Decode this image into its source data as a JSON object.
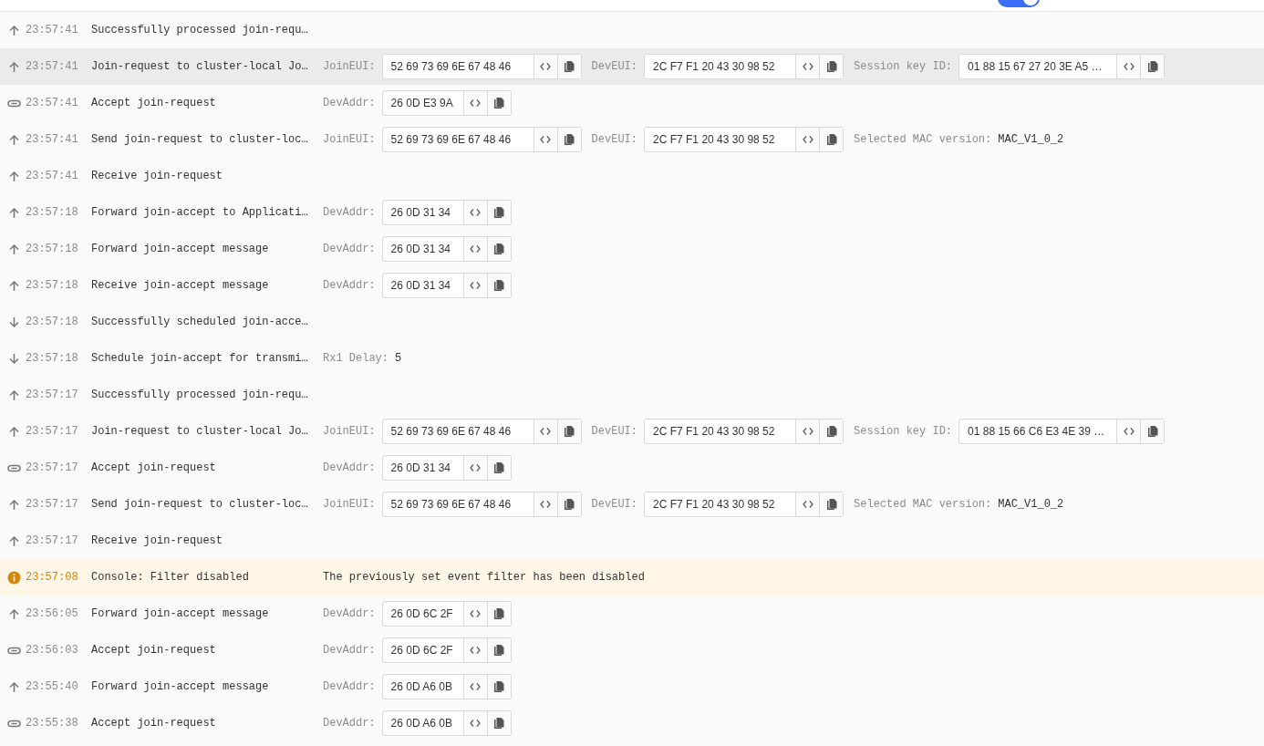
{
  "top_bar": {
    "toggle": {
      "on": true
    }
  },
  "events": [
    {
      "kind": "up",
      "time": "23:57:41",
      "title": "Successfully processed join-requ…",
      "selected": false
    },
    {
      "kind": "up",
      "time": "23:57:41",
      "title": "Join-request to cluster-local Jo…",
      "selected": true,
      "fields": [
        {
          "kind": "hex",
          "label": "JoinEUI:",
          "value": "52 69 73 69 6E 67 48 46"
        },
        {
          "kind": "hex",
          "label": "DevEUI:",
          "value": "2C F7 F1 20 43 30 98 52"
        },
        {
          "kind": "hex",
          "label": "Session key ID:",
          "value": "01 88 15 67 27 20 3E A5 …"
        }
      ]
    },
    {
      "kind": "link",
      "time": "23:57:41",
      "title": "Accept join-request",
      "selected": false,
      "fields": [
        {
          "kind": "hex",
          "label": "DevAddr:",
          "value": "26 0D E3 9A"
        }
      ]
    },
    {
      "kind": "up",
      "time": "23:57:41",
      "title": "Send join-request to cluster-loc…",
      "selected": false,
      "fields": [
        {
          "kind": "hex",
          "label": "JoinEUI:",
          "value": "52 69 73 69 6E 67 48 46"
        },
        {
          "kind": "hex",
          "label": "DevEUI:",
          "value": "2C F7 F1 20 43 30 98 52"
        },
        {
          "kind": "text",
          "label": "Selected MAC version:",
          "value": "MAC_V1_0_2"
        }
      ]
    },
    {
      "kind": "up",
      "time": "23:57:41",
      "title": "Receive join-request",
      "selected": false
    },
    {
      "kind": "up",
      "time": "23:57:18",
      "title": "Forward join-accept to Applicati…",
      "selected": false,
      "fields": [
        {
          "kind": "hex",
          "label": "DevAddr:",
          "value": "26 0D 31 34"
        }
      ]
    },
    {
      "kind": "up",
      "time": "23:57:18",
      "title": "Forward join-accept message",
      "selected": false,
      "fields": [
        {
          "kind": "hex",
          "label": "DevAddr:",
          "value": "26 0D 31 34"
        }
      ]
    },
    {
      "kind": "up",
      "time": "23:57:18",
      "title": "Receive join-accept message",
      "selected": false,
      "fields": [
        {
          "kind": "hex",
          "label": "DevAddr:",
          "value": "26 0D 31 34"
        }
      ]
    },
    {
      "kind": "down",
      "time": "23:57:18",
      "title": "Successfully scheduled join-acce…",
      "selected": false
    },
    {
      "kind": "down",
      "time": "23:57:18",
      "title": "Schedule join-accept for transmi…",
      "selected": false,
      "fields": [
        {
          "kind": "text",
          "label": "Rx1 Delay:",
          "value": "5"
        }
      ]
    },
    {
      "kind": "up",
      "time": "23:57:17",
      "title": "Successfully processed join-requ…",
      "selected": false
    },
    {
      "kind": "up",
      "time": "23:57:17",
      "title": "Join-request to cluster-local Jo…",
      "selected": false,
      "fields": [
        {
          "kind": "hex",
          "label": "JoinEUI:",
          "value": "52 69 73 69 6E 67 48 46"
        },
        {
          "kind": "hex",
          "label": "DevEUI:",
          "value": "2C F7 F1 20 43 30 98 52"
        },
        {
          "kind": "hex",
          "label": "Session key ID:",
          "value": "01 88 15 66 C6 E3 4E 39 …"
        }
      ]
    },
    {
      "kind": "link",
      "time": "23:57:17",
      "title": "Accept join-request",
      "selected": false,
      "fields": [
        {
          "kind": "hex",
          "label": "DevAddr:",
          "value": "26 0D 31 34"
        }
      ]
    },
    {
      "kind": "up",
      "time": "23:57:17",
      "title": "Send join-request to cluster-loc…",
      "selected": false,
      "fields": [
        {
          "kind": "hex",
          "label": "JoinEUI:",
          "value": "52 69 73 69 6E 67 48 46"
        },
        {
          "kind": "hex",
          "label": "DevEUI:",
          "value": "2C F7 F1 20 43 30 98 52"
        },
        {
          "kind": "text",
          "label": "Selected MAC version:",
          "value": "MAC_V1_0_2"
        }
      ]
    },
    {
      "kind": "up",
      "time": "23:57:17",
      "title": "Receive join-request",
      "selected": false
    },
    {
      "kind": "info",
      "time": "23:57:08",
      "title": "Console: Filter disabled",
      "selected": false,
      "fields": [
        {
          "kind": "message",
          "value": "The previously set event filter has been disabled"
        }
      ]
    },
    {
      "kind": "up",
      "time": "23:56:05",
      "title": "Forward join-accept message",
      "selected": false,
      "fields": [
        {
          "kind": "hex",
          "label": "DevAddr:",
          "value": "26 0D 6C 2F"
        }
      ]
    },
    {
      "kind": "link",
      "time": "23:56:03",
      "title": "Accept join-request",
      "selected": false,
      "fields": [
        {
          "kind": "hex",
          "label": "DevAddr:",
          "value": "26 0D 6C 2F"
        }
      ]
    },
    {
      "kind": "up",
      "time": "23:55:40",
      "title": "Forward join-accept message",
      "selected": false,
      "fields": [
        {
          "kind": "hex",
          "label": "DevAddr:",
          "value": "26 0D A6 0B"
        }
      ]
    },
    {
      "kind": "link",
      "time": "23:55:38",
      "title": "Accept join-request",
      "selected": false,
      "fields": [
        {
          "kind": "hex",
          "label": "DevAddr:",
          "value": "26 0D A6 0B"
        }
      ]
    }
  ]
}
